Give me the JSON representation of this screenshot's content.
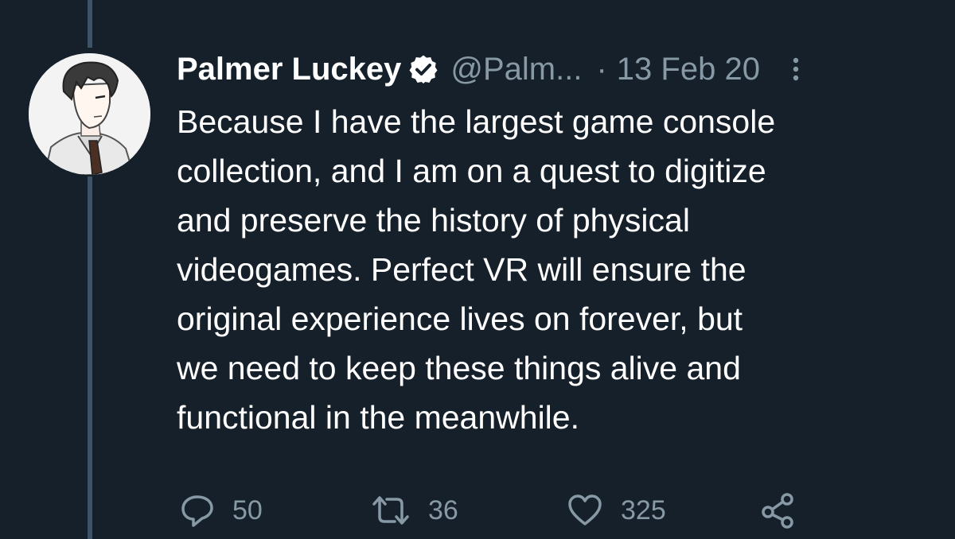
{
  "tweet": {
    "display_name": "Palmer Luckey",
    "handle": "@Palm...",
    "separator": "·",
    "date": "13 Feb 20",
    "text": "Because I have the largest game console\ncollection, and I am on a quest to digitize\nand preserve the history of physical\nvideogames.  Perfect VR will ensure the\noriginal experience lives on forever, but\nwe need to keep these things alive and\nfunctional in the meanwhile.",
    "verified": true
  },
  "actions": {
    "reply_count": "50",
    "retweet_count": "36",
    "like_count": "325",
    "reply_icon": "reply-icon",
    "retweet_icon": "retweet-icon",
    "like_icon": "heart-icon",
    "share_icon": "share-icon"
  },
  "colors": {
    "background": "#15202b",
    "primary_text": "#ffffff",
    "secondary_text": "#8899a6",
    "thread_line": "#3d5466",
    "verified_badge": "#ffffff"
  }
}
